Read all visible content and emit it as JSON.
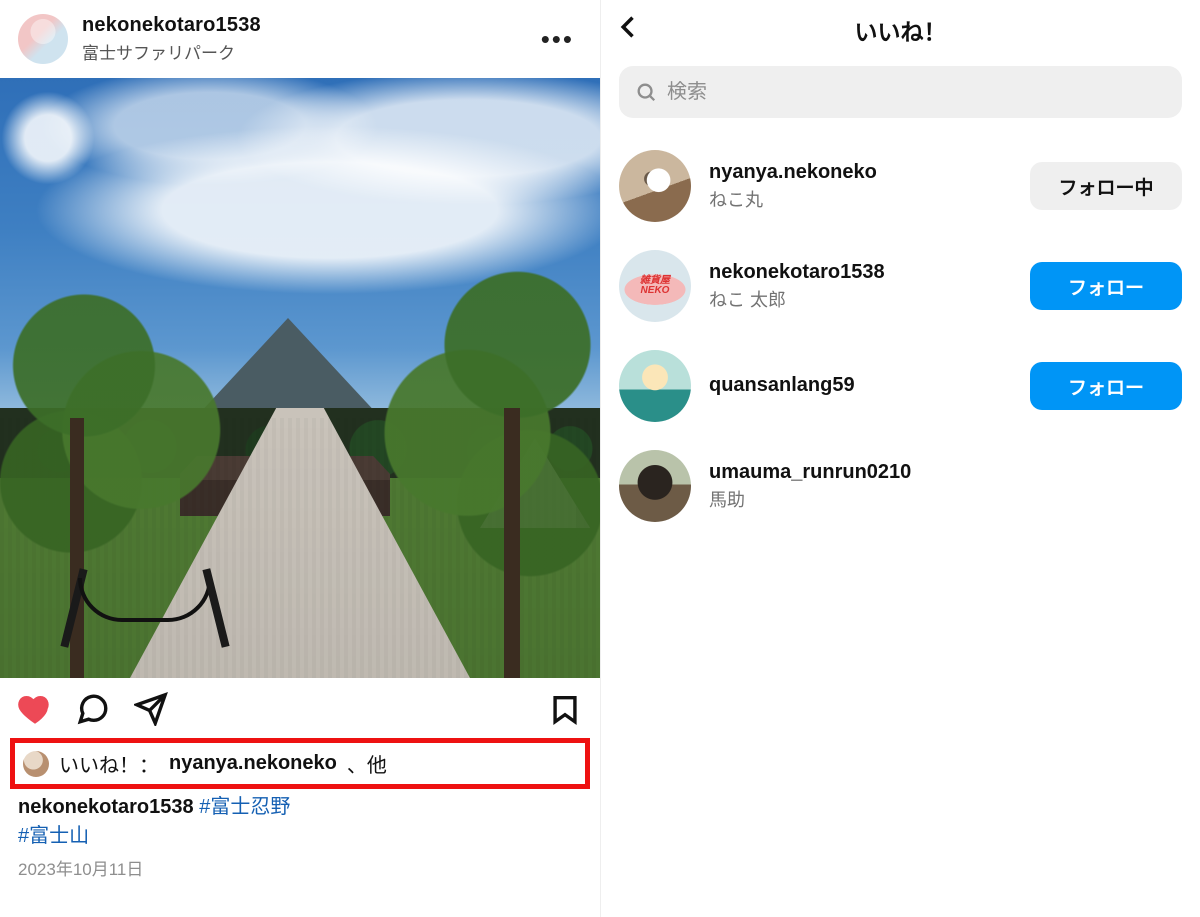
{
  "post": {
    "username": "nekonekotaro1538",
    "location": "富士サファリパーク",
    "liked_by_label": "いいね！：",
    "liked_by_name": "nyanya.nekoneko",
    "liked_by_suffix": "、他",
    "caption_username": "nekonekotaro1538",
    "caption_tag1": "#富士忍野",
    "caption_tag2": "#富士山",
    "date": "2023年10月11日"
  },
  "likes_panel": {
    "title": "いいね！",
    "search_placeholder": "検索",
    "button_following": "フォロー中",
    "button_follow": "フォロー",
    "users": [
      {
        "username": "nyanya.nekoneko",
        "display": "ねこ丸",
        "state": "following"
      },
      {
        "username": "nekonekotaro1538",
        "display": "ねこ 太郎",
        "state": "follow"
      },
      {
        "username": "quansanlang59",
        "display": "",
        "state": "follow"
      },
      {
        "username": "umauma_runrun0210",
        "display": "馬助",
        "state": "none"
      }
    ]
  }
}
